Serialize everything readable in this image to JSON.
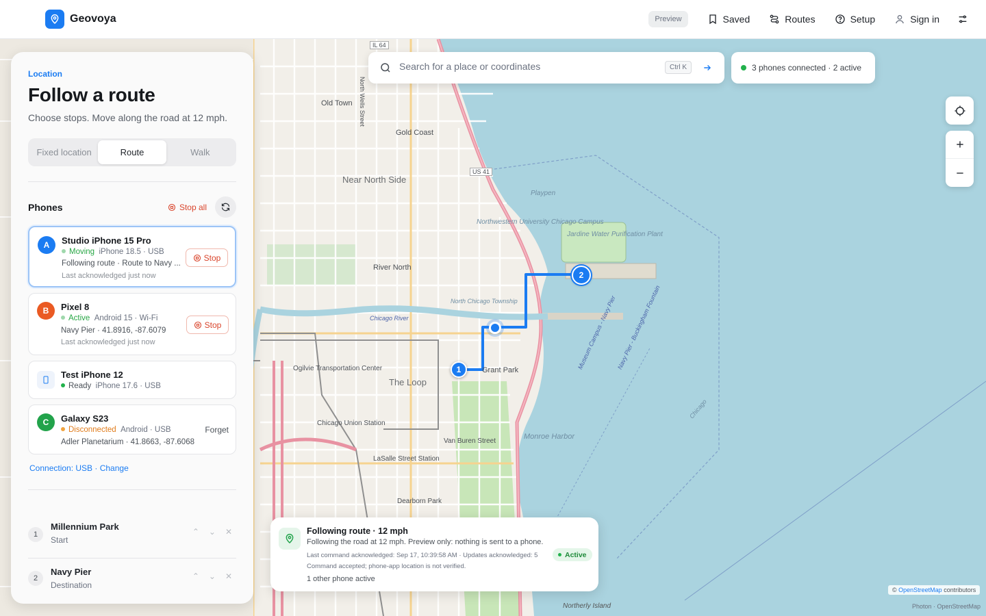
{
  "app": {
    "name": "Geovoya",
    "logo_icon": "map-pin-icon"
  },
  "nav": {
    "preview": "Preview",
    "saved": "Saved",
    "routes": "Routes",
    "setup": "Setup",
    "sign_in": "Sign in"
  },
  "panel": {
    "eyebrow": "Location",
    "title": "Follow a route",
    "subtitle": "Choose stops. Move along the road at 12 mph.",
    "modes": [
      "Fixed location",
      "Route",
      "Walk"
    ],
    "selected_mode": "Route",
    "phones_title": "Phones",
    "stop_all": "Stop all",
    "phones": [
      {
        "badge": "A",
        "color": "#1b7cf2",
        "name": "Studio iPhone 15 Pro",
        "status": "Moving",
        "status_color": "#28a745",
        "device": "iPhone 18.5 · USB",
        "activity": "Following route · Route to Navy ...",
        "ack": "Last acknowledged just now",
        "action": "Stop"
      },
      {
        "badge": "B",
        "color": "#ea5a23",
        "name": "Pixel 8",
        "status": "Active",
        "status_color": "#28a745",
        "device": "Android 15 · Wi-Fi",
        "activity": "Navy Pier · 41.8916, -87.6079",
        "ack": "Last acknowledged just now",
        "action": "Stop"
      },
      {
        "badge": "",
        "color": "#1b7cf2",
        "name": "Test iPhone 12",
        "status": "Ready",
        "status_color": "#28a745",
        "device": "iPhone 17.6 · USB"
      },
      {
        "badge": "C",
        "color": "#22a34b",
        "name": "Galaxy S23",
        "status": "Disconnected",
        "status_color": "#e07b1a",
        "device": "Android · USB",
        "activity": "Adler Planetarium · 41.8663, -87.6068",
        "action": "Forget"
      }
    ],
    "connection": "Connection: USB · Change",
    "stops": [
      {
        "num": "1",
        "name": "Millennium Park",
        "role": "Start"
      },
      {
        "num": "2",
        "name": "Navy Pier",
        "role": "Destination"
      }
    ]
  },
  "search": {
    "placeholder": "Search for a place or coordinates",
    "shortcut": "Ctrl K"
  },
  "connection_status": "3 phones connected · 2 active",
  "route_card": {
    "title": "Following route · 12 mph",
    "description": "Following the road at 12 mph. Preview only: nothing is sent to a phone.",
    "last_command": "Last command acknowledged: Sep 17, 10:39:58 AM · Updates acknowledged: 5",
    "command_note": "Command accepted; phone-app location is not verified.",
    "other": "1 other phone active",
    "badge": "Active"
  },
  "map": {
    "labels": [
      "Old Town",
      "Gold Coast",
      "Near North Side",
      "River North",
      "The Loop",
      "Playpen",
      "Jardine Water Purification Plant",
      "Northwestern University Chicago Campus",
      "Grant Park",
      "Monroe Harbor",
      "Van Buren Street",
      "Ogilvie Transportation Center",
      "Chicago Union Station",
      "LaSalle Street Station",
      "Dearborn Park",
      "US 41",
      "IL 64",
      "North Chicago Township",
      "Museum Campus - Navy Pier",
      "Navy Pier - Buckingham Fountain",
      "Chicago",
      "Northerly Island",
      "North Wells Street",
      "Chicago River"
    ],
    "markers": [
      "1",
      "2"
    ],
    "route_color": "#1b7cf2",
    "water_color": "#aad3df",
    "park_color": "#c8facc"
  },
  "attribution": {
    "symbol": "©",
    "link": "OpenStreetMap",
    "text": "contributors"
  },
  "photon": "Photon · OpenStreetMap"
}
